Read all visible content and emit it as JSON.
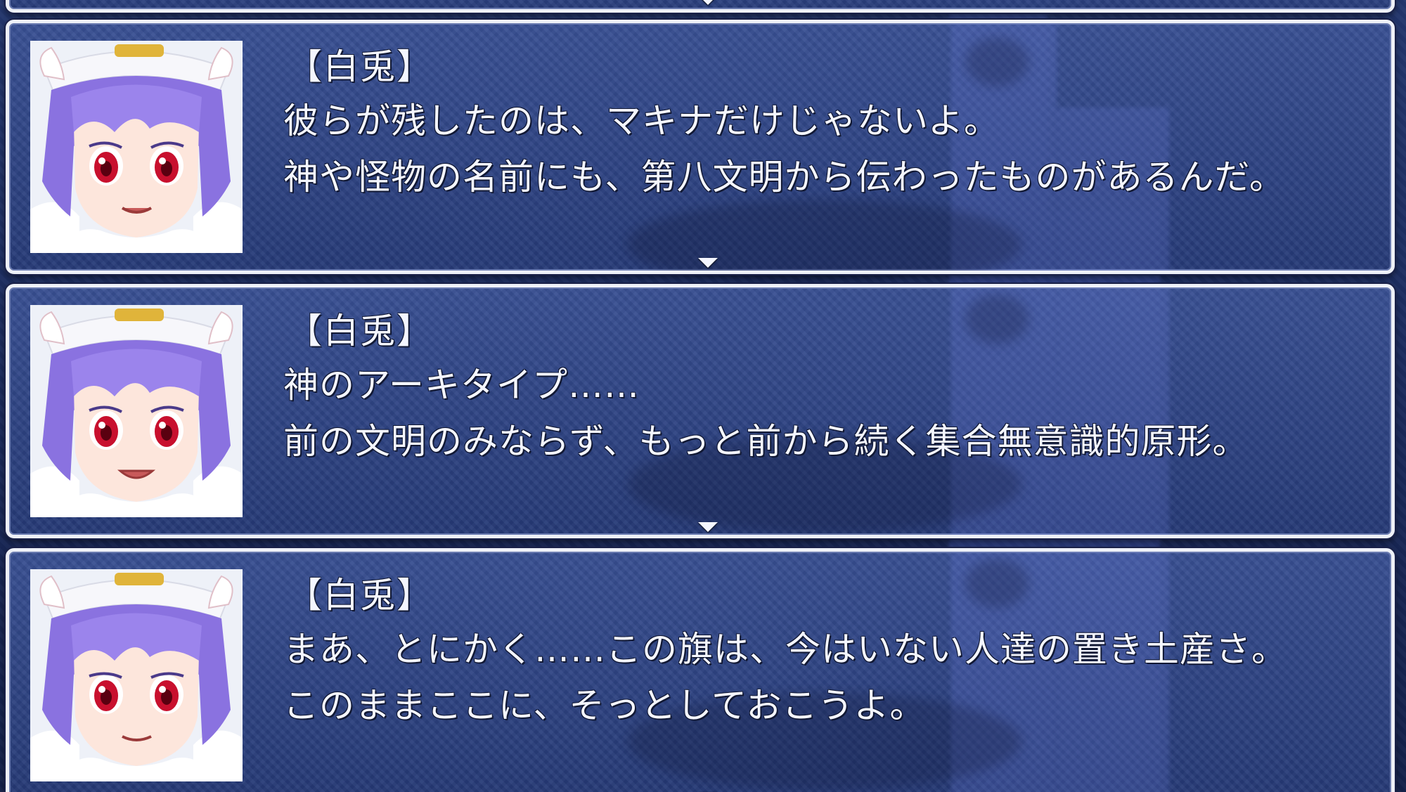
{
  "colors": {
    "window_frame": "#eef1f8",
    "window_fill": "#2e4690",
    "text": "#f4f6ff",
    "hair": "#8a72e0",
    "eyes": "#c8102e"
  },
  "windows": [
    {
      "portrait_icon": "shiro-usagi-portrait",
      "speaker": "【白兎】",
      "lines": [
        "彼らが残したのは、マキナだけじゃないよ。",
        "神や怪物の名前にも、第八文明から伝わったものがあるんだ。"
      ]
    },
    {
      "portrait_icon": "shiro-usagi-portrait",
      "speaker": "【白兎】",
      "lines": [
        "神のアーキタイプ……",
        "前の文明のみならず、もっと前から続く集合無意識的原形。"
      ]
    },
    {
      "portrait_icon": "shiro-usagi-portrait",
      "speaker": "【白兎】",
      "lines": [
        "まあ、とにかく……この旗は、今はいない人達の置き土産さ。",
        "このままここに、そっとしておこうよ。"
      ]
    }
  ]
}
